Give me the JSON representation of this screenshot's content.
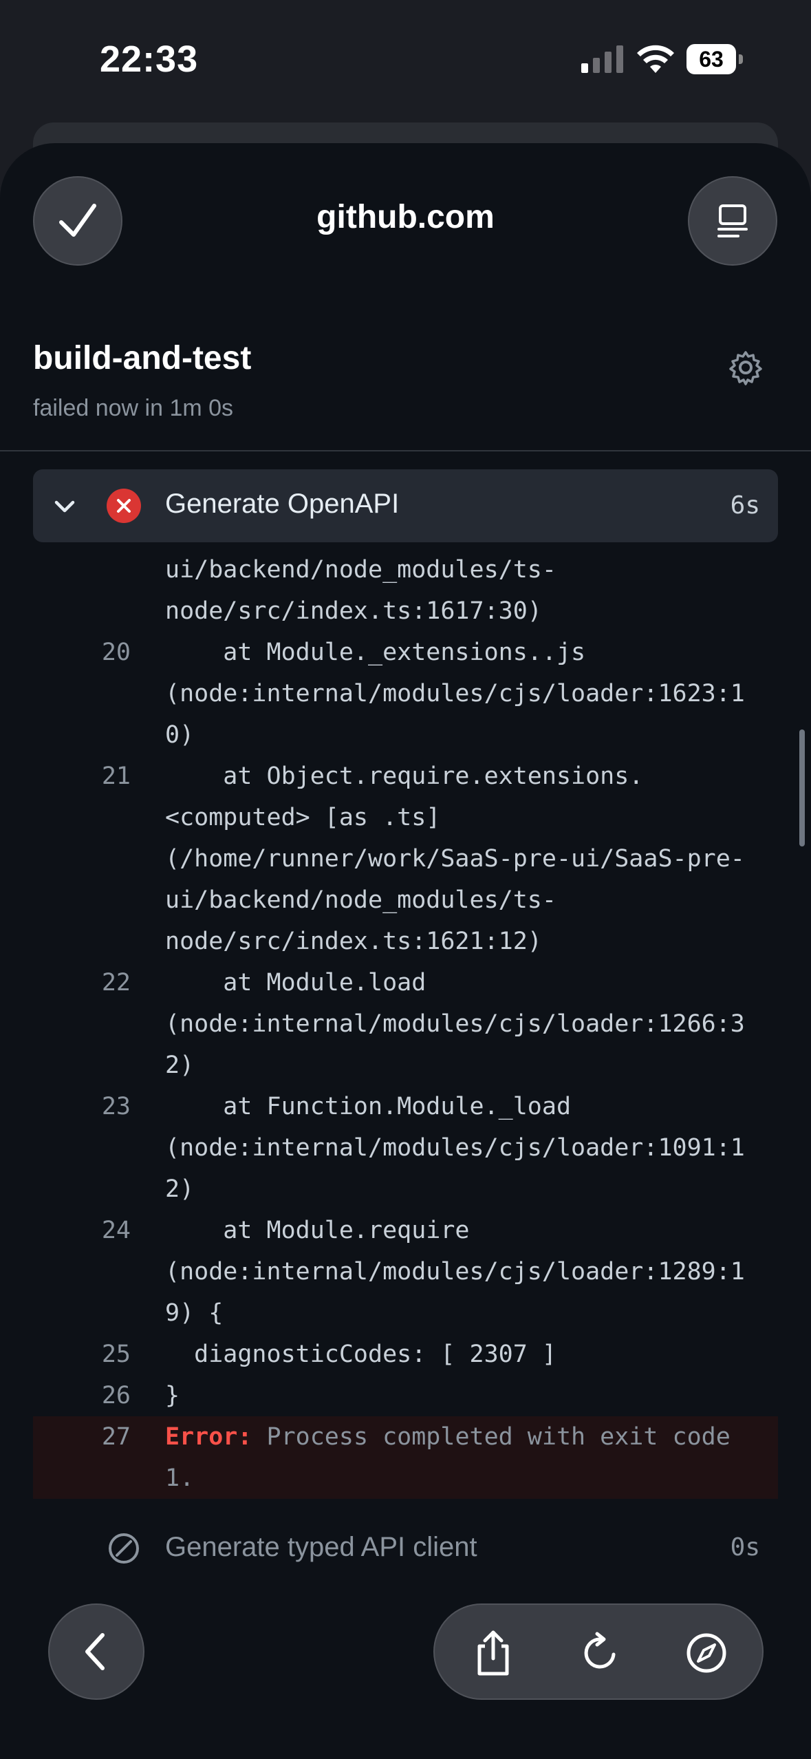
{
  "status_bar": {
    "time": "22:33",
    "battery": "63"
  },
  "browser": {
    "site": "github.com"
  },
  "job": {
    "title": "build-and-test",
    "subtitle": "failed now in 1m 0s"
  },
  "steps": [
    {
      "name": "Generate OpenAPI",
      "duration": "6s",
      "status": "failed"
    },
    {
      "name": "Generate typed API client",
      "duration": "0s",
      "status": "skipped"
    }
  ],
  "log_lines": [
    {
      "num": "",
      "text": "ui/backend/node_modules/ts-"
    },
    {
      "num": "",
      "text": "node/src/index.ts:1617:30)"
    },
    {
      "num": "20",
      "text": "    at Module._extensions..js"
    },
    {
      "num": "",
      "text": "(node:internal/modules/cjs/loader:1623:1"
    },
    {
      "num": "",
      "text": "0)"
    },
    {
      "num": "21",
      "text": "    at Object.require.extensions."
    },
    {
      "num": "",
      "text": "<computed> [as .ts]"
    },
    {
      "num": "",
      "text": "(/home/runner/work/SaaS-pre-ui/SaaS-pre-"
    },
    {
      "num": "",
      "text": "ui/backend/node_modules/ts-"
    },
    {
      "num": "",
      "text": "node/src/index.ts:1621:12)"
    },
    {
      "num": "22",
      "text": "    at Module.load"
    },
    {
      "num": "",
      "text": "(node:internal/modules/cjs/loader:1266:3"
    },
    {
      "num": "",
      "text": "2)"
    },
    {
      "num": "23",
      "text": "    at Function.Module._load"
    },
    {
      "num": "",
      "text": "(node:internal/modules/cjs/loader:1091:1"
    },
    {
      "num": "",
      "text": "2)"
    },
    {
      "num": "24",
      "text": "    at Module.require"
    },
    {
      "num": "",
      "text": "(node:internal/modules/cjs/loader:1289:1"
    },
    {
      "num": "",
      "text": "9) {"
    },
    {
      "num": "25",
      "text": "  diagnosticCodes: [ 2307 ]"
    },
    {
      "num": "26",
      "text": "}"
    }
  ],
  "error_line": {
    "num": "27",
    "keyword": "Error:",
    "text": " Process completed with exit code",
    "text_cont": "1."
  },
  "colors": {
    "error": "#da3633",
    "sheet": "#0d1117",
    "step_header": "#252a33"
  }
}
